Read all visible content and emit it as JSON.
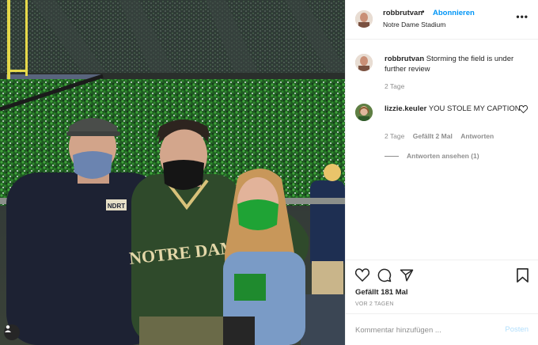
{
  "post": {
    "author": "robbrutvan",
    "separator": "•",
    "follow_label": "Abonnieren",
    "location": "Notre Dame Stadium",
    "more_label": "•••"
  },
  "photo": {
    "jersey_text": "NOTRE DAME",
    "jacket_logo": "NDRT"
  },
  "comments": [
    {
      "user": "robbrutvan",
      "text": "Storming the field is under further review",
      "time": "2 Tage"
    },
    {
      "user": "lizzie.keuler",
      "text": "YOU STOLE MY CAPTION",
      "time": "2 Tage",
      "likes": "Gefällt 2 Mal",
      "reply_label": "Antworten",
      "view_replies": "Antworten ansehen (1)"
    }
  ],
  "actions": {
    "like_icon": "heart-icon",
    "comment_icon": "comment-icon",
    "share_icon": "share-icon",
    "save_icon": "bookmark-icon"
  },
  "likes_count_text": "Gefällt 181 Mal",
  "posted_ago": "VOR 2 TAGEN",
  "add_comment": {
    "placeholder": "Kommentar hinzufügen ...",
    "post_label": "Posten"
  },
  "colors": {
    "link_blue": "#0095f6",
    "post_disabled": "#b2dffc",
    "text": "#262626",
    "muted": "#8e8e8e",
    "border": "#efefef"
  }
}
